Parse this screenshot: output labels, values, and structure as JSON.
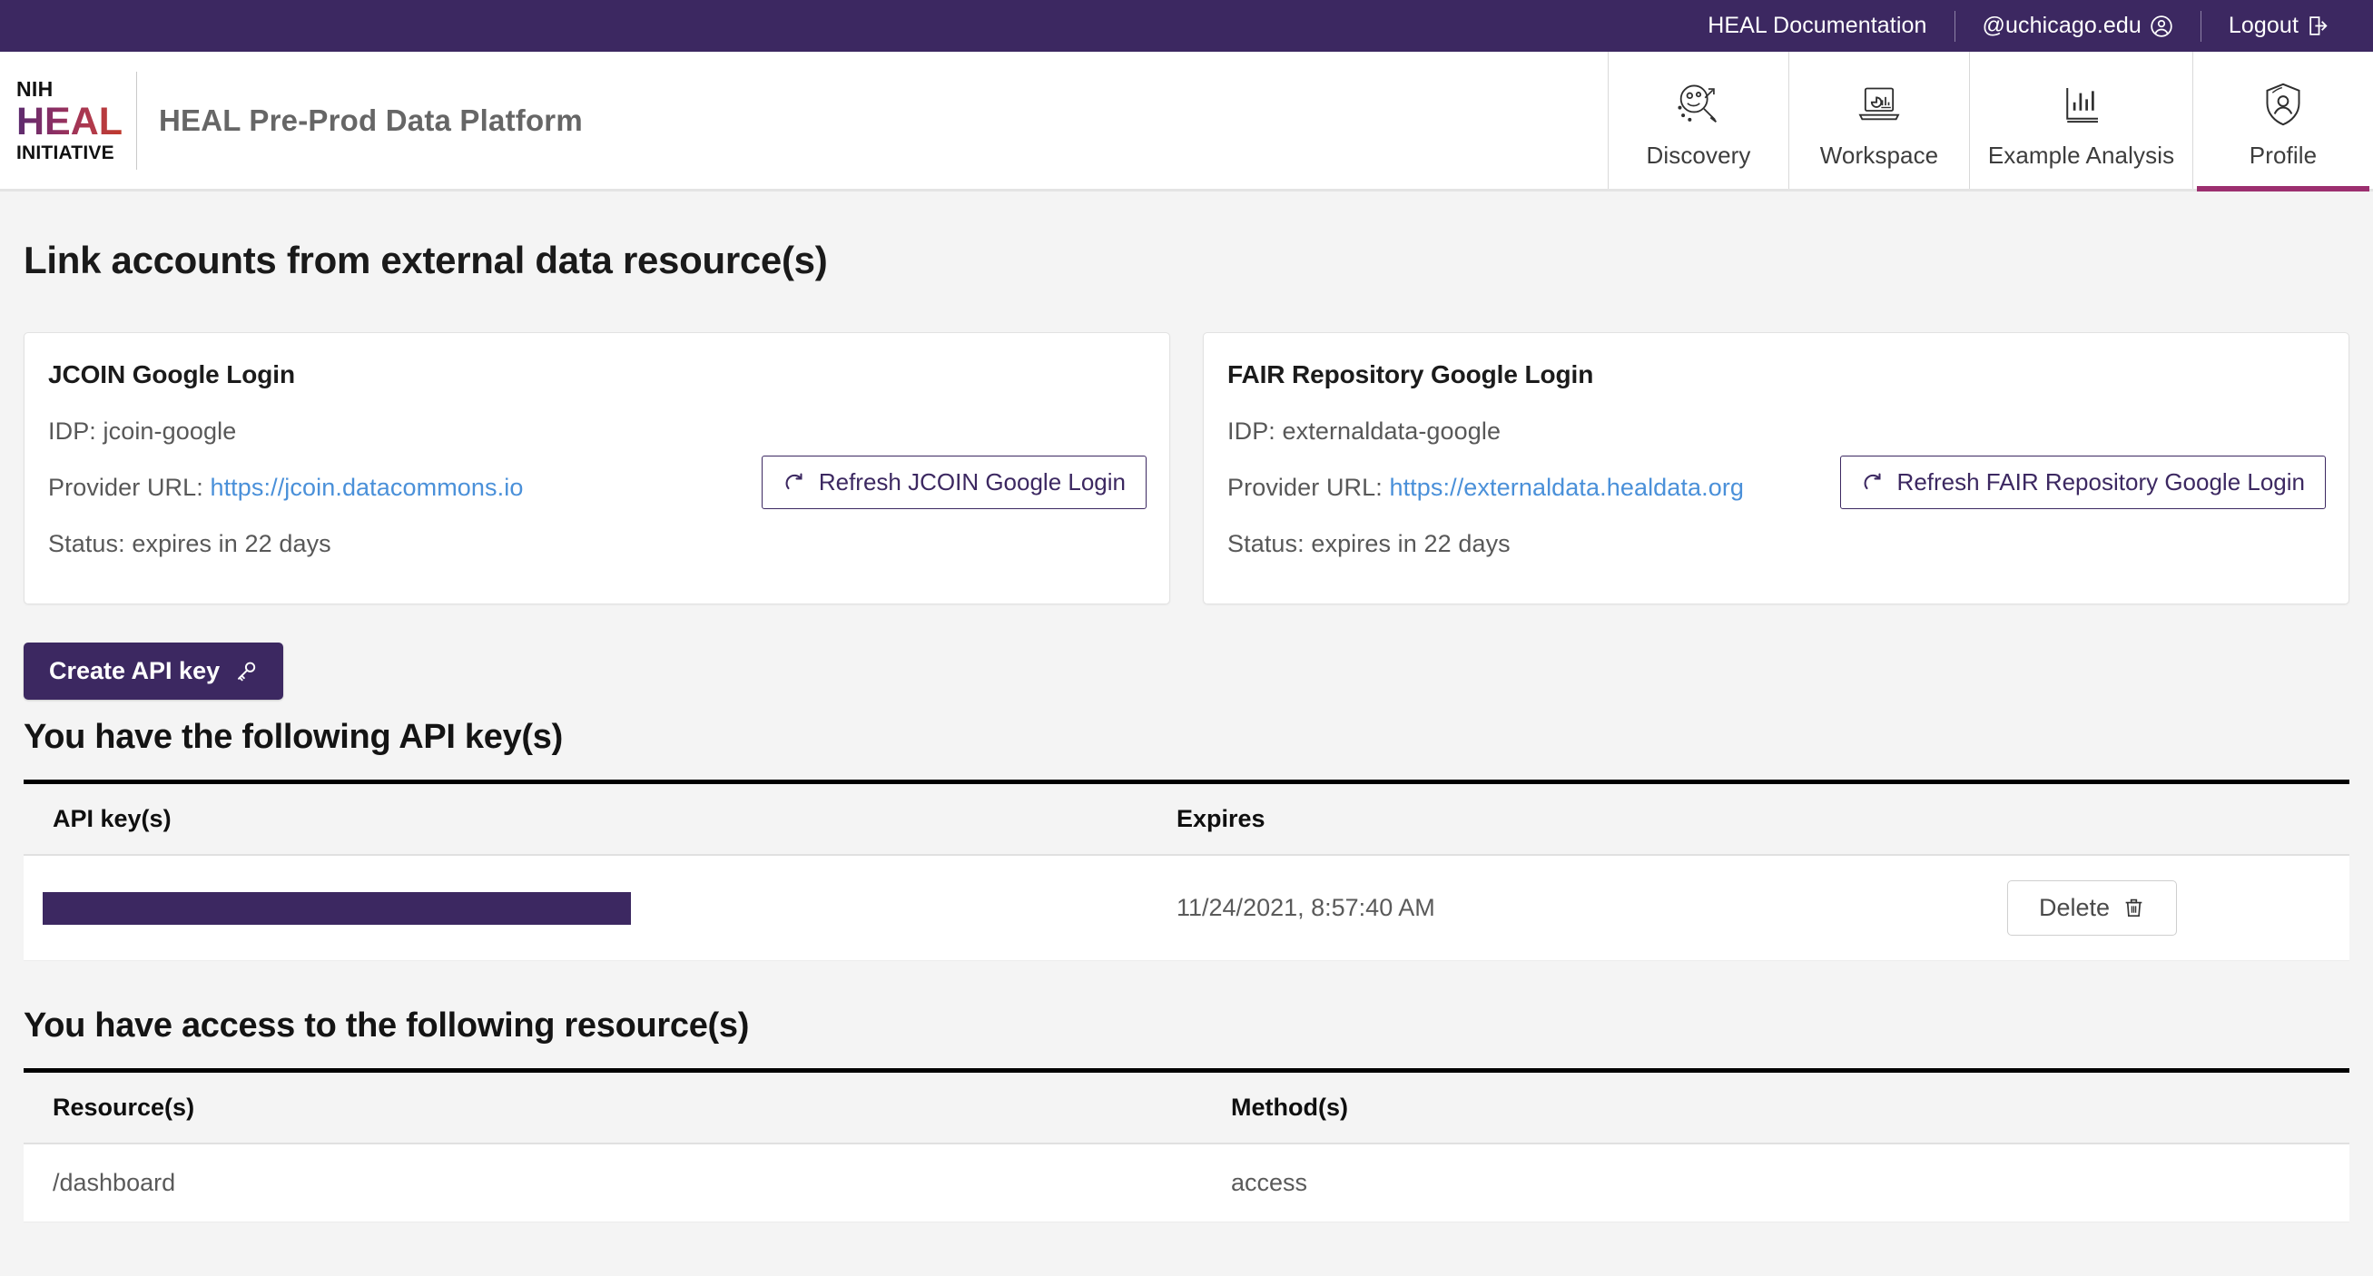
{
  "topbar": {
    "links": [
      {
        "label": "HEAL Documentation",
        "icon": null
      },
      {
        "label": "@uchicago.edu",
        "icon": "user-circle-icon"
      },
      {
        "label": "Logout",
        "icon": "logout-icon"
      }
    ]
  },
  "header": {
    "logo": {
      "line1": "NIH",
      "line2": "HEAL",
      "line3": "INITIATIVE"
    },
    "title": "HEAL Pre-Prod Data Platform",
    "tabs": [
      {
        "label": "Discovery",
        "icon": "magnifier-discovery-icon",
        "active": false
      },
      {
        "label": "Workspace",
        "icon": "laptop-chart-icon",
        "active": false
      },
      {
        "label": "Example Analysis",
        "icon": "bar-chart-icon",
        "active": false
      },
      {
        "label": "Profile",
        "icon": "shield-user-icon",
        "active": true
      }
    ]
  },
  "page": {
    "title": "Link accounts from external data resource(s)"
  },
  "cards": [
    {
      "title": "JCOIN Google Login",
      "idp_label": "IDP: ",
      "idp_value": "jcoin-google",
      "provider_label": "Provider URL: ",
      "provider_url": "https://jcoin.datacommons.io",
      "status": "Status: expires in 22 days",
      "refresh_label": "Refresh JCOIN Google Login"
    },
    {
      "title": "FAIR Repository Google Login",
      "idp_label": "IDP: ",
      "idp_value": "externaldata-google",
      "provider_label": "Provider URL: ",
      "provider_url": "https://externaldata.healdata.org",
      "status": "Status: expires in 22 days",
      "refresh_label": "Refresh FAIR Repository Google Login"
    }
  ],
  "api_keys": {
    "create_button": "Create API key",
    "section_title": "You have the following API key(s)",
    "columns": {
      "key": "API key(s)",
      "expires": "Expires",
      "action": ""
    },
    "rows": [
      {
        "key_redacted": true,
        "expires": "11/24/2021, 8:57:40 AM",
        "delete_label": "Delete"
      }
    ]
  },
  "resources": {
    "section_title": "You have access to the following resource(s)",
    "columns": {
      "resource": "Resource(s)",
      "method": "Method(s)"
    },
    "rows": [
      {
        "resource": "/dashboard",
        "method": "access"
      }
    ]
  },
  "colors": {
    "brand_purple": "#3c2861",
    "accent_magenta": "#9c2f6f",
    "link_blue": "#4a90d9",
    "page_bg": "#f4f4f4"
  }
}
